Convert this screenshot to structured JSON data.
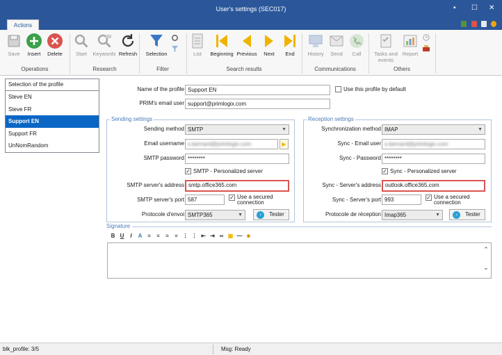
{
  "window": {
    "title": "User's settings (SEC017)",
    "minimize": "▪",
    "maximize": "☐",
    "close": "✕"
  },
  "ribbon": {
    "tab": "Actions",
    "operations": {
      "label": "Operations",
      "save": "Save",
      "insert": "Insert",
      "delete": "Delete"
    },
    "research": {
      "label": "Research",
      "start": "Start",
      "keywords": "Keywords",
      "refresh": "Refresh"
    },
    "filter": {
      "label": "Filter",
      "selection": "Selection"
    },
    "search_results": {
      "label": "Search results",
      "list": "List",
      "beginning": "Beginning",
      "previous": "Previous",
      "next": "Next",
      "end": "End"
    },
    "communications": {
      "label": "Communications",
      "history": "History",
      "send": "Send",
      "call": "Call"
    },
    "others": {
      "label": "Others",
      "tasks_line1": "Tasks and",
      "tasks_line2": "events",
      "report": "Report"
    }
  },
  "profiles": {
    "header": "Selection of the profile",
    "items": [
      "Steve EN",
      "Steve FR",
      "Support EN",
      "Support FR",
      "UnNomRandom"
    ],
    "selected": "Support EN"
  },
  "form": {
    "profile_name_label": "Name of the profile",
    "profile_name": "Support EN",
    "default_label": "Use this profile by default",
    "email_label": "PRIM's email user",
    "email": "support@primlogix.com"
  },
  "sending": {
    "title": "Sending settings",
    "method_label": "Sending method",
    "method": "SMTP",
    "username_label": "Email username",
    "username": "s.bernard@primlogix.com",
    "password_label": "SMTP password",
    "password": "********",
    "personalized_label": "SMTP - Personalized server",
    "server_label": "SMTP server's address",
    "server": "smtp.office365.com",
    "port_label": "SMTP server's port",
    "port": "587",
    "secured_line1": "Use a secured",
    "secured_line2": "connection",
    "protocol_label": "Protocole d'envoi",
    "protocol": "SMTP365",
    "tester": "Tester"
  },
  "reception": {
    "title": "Reception settings",
    "method_label": "Synchronization method",
    "method": "IMAP",
    "username_label": "Sync - Email user",
    "username": "s.bernard@primlogix.com",
    "password_label": "Sync - Password",
    "password": "********",
    "personalized_label": "Sync - Personalized server",
    "server_label": "Sync - Server's address",
    "server": "outlook.office365.com",
    "port_label": "Sync - Server's port",
    "port": "993",
    "secured_line1": "Use a secured",
    "secured_line2": "connection",
    "protocol_label": "Protocole de réception",
    "protocol": "Imap365",
    "tester": "Tester"
  },
  "signature": {
    "title": "Signature"
  },
  "status": {
    "record": "blk_profile: 3/5",
    "message": "Msg: Ready"
  },
  "colors": {
    "titlebar": "#2b579a",
    "selected": "#0a66c5",
    "highlight": "#d9534f"
  }
}
